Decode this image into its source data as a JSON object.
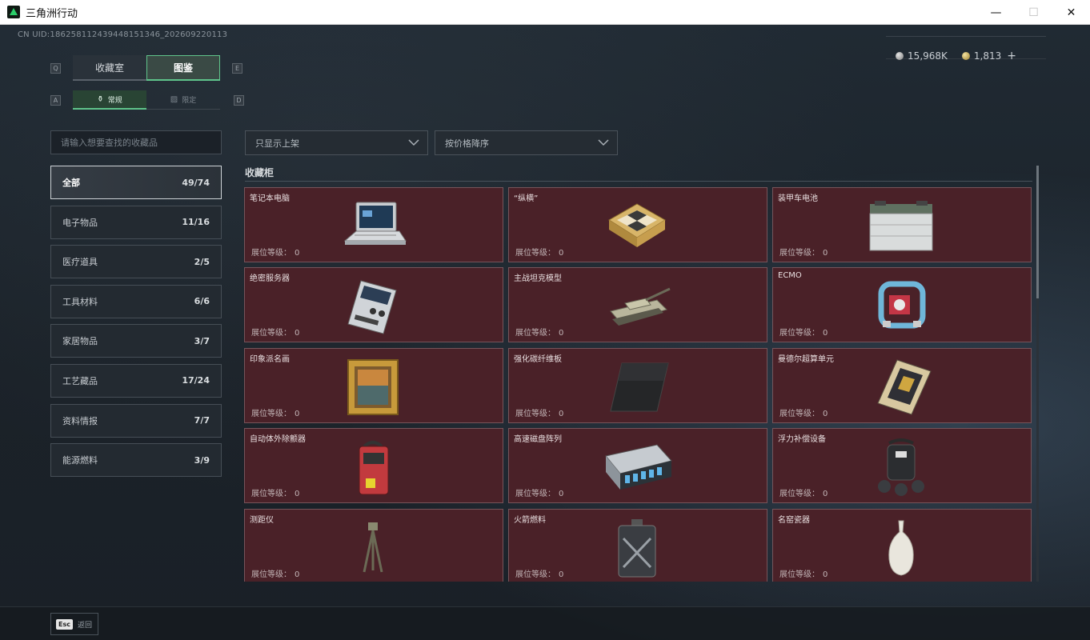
{
  "window": {
    "title": "三角洲行动",
    "minimize": "—",
    "maximize": "☐",
    "close": "✕"
  },
  "header": {
    "uid": "CN UID:1862581124394481513​46_202609220113",
    "currency": [
      {
        "icon": "silver-coin-icon",
        "value": "15,968K"
      },
      {
        "icon": "gold-coin-icon",
        "value": "1,813"
      }
    ],
    "add": "+"
  },
  "keys": {
    "prev_tab": "Q",
    "next_tab": "E",
    "prev_sub": "A",
    "next_sub": "D"
  },
  "tabs": [
    {
      "label": "收藏室",
      "active": false
    },
    {
      "label": "图鉴",
      "active": true
    }
  ],
  "subtabs": [
    {
      "icon": "bottle-icon",
      "glyph": "⚱",
      "label": "常规",
      "active": true
    },
    {
      "icon": "image-icon",
      "glyph": "▨",
      "label": "限定",
      "active": false
    }
  ],
  "search": {
    "placeholder": "请输入想要查找的收藏品"
  },
  "categories": [
    {
      "label": "全部",
      "count": "49/74",
      "active": true
    },
    {
      "label": "电子物品",
      "count": "11/16"
    },
    {
      "label": "医疗道具",
      "count": "2/5"
    },
    {
      "label": "工具材料",
      "count": "6/6"
    },
    {
      "label": "家居物品",
      "count": "3/7"
    },
    {
      "label": "工艺藏品",
      "count": "17/24"
    },
    {
      "label": "资料情报",
      "count": "7/7"
    },
    {
      "label": "能源燃料",
      "count": "3/9"
    }
  ],
  "filters": {
    "show": "只显示上架",
    "sort": "按价格降序"
  },
  "section": {
    "title": "收藏柜"
  },
  "level_label": "展位等级：",
  "items": [
    {
      "name": "笔记本电脑",
      "level": "0",
      "icon": "laptop-icon"
    },
    {
      "name": "“纵横”",
      "level": "0",
      "icon": "chessboard-icon"
    },
    {
      "name": "装甲车电池",
      "level": "0",
      "icon": "battery-icon"
    },
    {
      "name": "绝密服务器",
      "level": "0",
      "icon": "server-icon"
    },
    {
      "name": "主战坦克模型",
      "level": "0",
      "icon": "tank-icon"
    },
    {
      "name": "ECMO",
      "level": "0",
      "icon": "ecmo-icon"
    },
    {
      "name": "印象派名画",
      "level": "0",
      "icon": "painting-icon"
    },
    {
      "name": "强化碳纤维板",
      "level": "0",
      "icon": "carbon-plate-icon"
    },
    {
      "name": "曼德尔超算单元",
      "level": "0",
      "icon": "supercomputer-unit-icon"
    },
    {
      "name": "自动体外除颤器",
      "level": "0",
      "icon": "defibrillator-icon"
    },
    {
      "name": "高速磁盘阵列",
      "level": "0",
      "icon": "disk-array-icon"
    },
    {
      "name": "浮力补偿设备",
      "level": "0",
      "icon": "buoyancy-device-icon"
    },
    {
      "name": "测距仪",
      "level": "0",
      "icon": "rangefinder-icon"
    },
    {
      "name": "火箭燃料",
      "level": "0",
      "icon": "fuel-can-icon"
    },
    {
      "name": "名窑瓷器",
      "level": "0",
      "icon": "porcelain-vase-icon"
    }
  ],
  "footer": {
    "esc_key": "Esc",
    "back": "返回"
  }
}
